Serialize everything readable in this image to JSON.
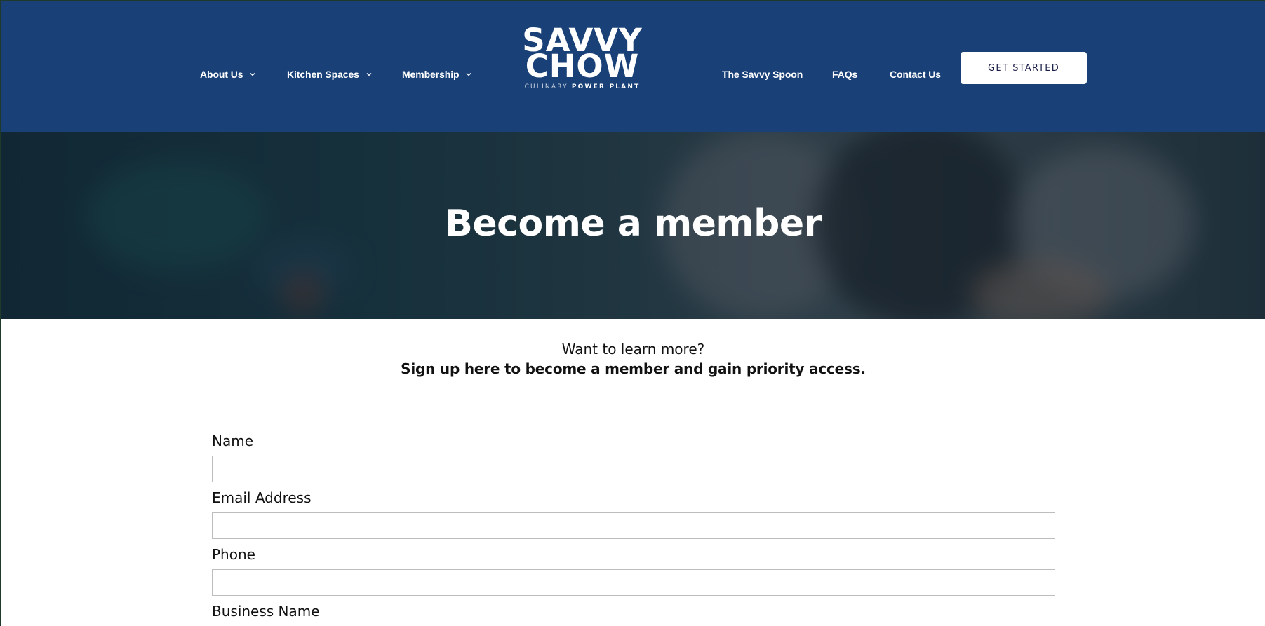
{
  "nav": {
    "left_items": [
      {
        "label": "About Us",
        "has_dropdown": true
      },
      {
        "label": "Kitchen Spaces",
        "has_dropdown": true
      },
      {
        "label": "Membership",
        "has_dropdown": true
      }
    ],
    "right_items": [
      {
        "label": "The Savvy Spoon"
      },
      {
        "label": "FAQs"
      },
      {
        "label": "Contact Us"
      }
    ],
    "cta_label": "GET STARTED"
  },
  "logo": {
    "line1": "SAVVY",
    "line2": "CHOW",
    "tagline_light": "CULINARY",
    "tagline_strong": "POWER PLANT"
  },
  "hero": {
    "title": "Become a member"
  },
  "intro": {
    "lead": "Want to learn more?",
    "strong": "Sign up here to become a member and gain priority access."
  },
  "form": {
    "fields": [
      {
        "label": "Name",
        "value": "",
        "placeholder": ""
      },
      {
        "label": "Email Address",
        "value": "",
        "placeholder": ""
      },
      {
        "label": "Phone",
        "value": "",
        "placeholder": ""
      },
      {
        "label": "Business Name",
        "value": "",
        "placeholder": ""
      }
    ]
  },
  "colors": {
    "header_bg": "#1a4177",
    "cta_bg": "#ffffff",
    "cta_text": "#1b1f4a",
    "text": "#111111",
    "input_border": "#bdbdbd"
  },
  "icons": {
    "dropdown": "chevron-down-icon"
  }
}
